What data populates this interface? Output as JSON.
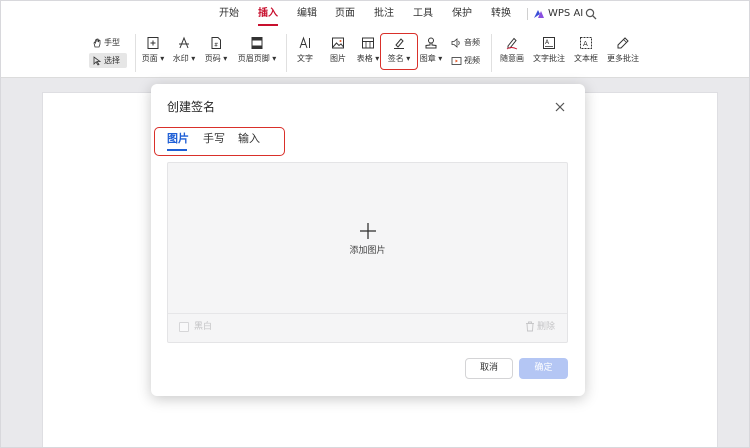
{
  "menu": {
    "tabs": [
      {
        "label": "开始",
        "active": false
      },
      {
        "label": "插入",
        "active": true
      },
      {
        "label": "编辑",
        "active": false
      },
      {
        "label": "页面",
        "active": false
      },
      {
        "label": "批注",
        "active": false
      },
      {
        "label": "工具",
        "active": false
      },
      {
        "label": "保护",
        "active": false
      },
      {
        "label": "转换",
        "active": false
      }
    ],
    "wps_ai_label": "WPS AI",
    "accent_color": "#c8102e"
  },
  "ribbon": {
    "hand_tool": "手型",
    "select_tool": "选择",
    "page_label": "页面",
    "watermark_label": "水印",
    "page_number_label": "页码",
    "header_footer_label": "页眉页脚",
    "text_label": "文字",
    "image_label": "图片",
    "table_label": "表格",
    "signature_label": "签名",
    "stamp_label": "图章",
    "audio_label": "音频",
    "video_label": "视频",
    "freehand_label": "随意画",
    "text_comment_label": "文字批注",
    "textbox_label": "文本框",
    "more_comments_label": "更多批注"
  },
  "dialog": {
    "title": "创建签名",
    "tabs": [
      {
        "label": "图片",
        "active": true
      },
      {
        "label": "手写",
        "active": false
      },
      {
        "label": "输入",
        "active": false
      }
    ],
    "add_image_label": "添加图片",
    "black_white_label": "黑白",
    "delete_label": "删除",
    "cancel_label": "取消",
    "confirm_label": "确定",
    "active_tab_color": "#1f5fd6",
    "confirm_color": "#b4c6f4"
  },
  "highlight_color": "#d9302a"
}
